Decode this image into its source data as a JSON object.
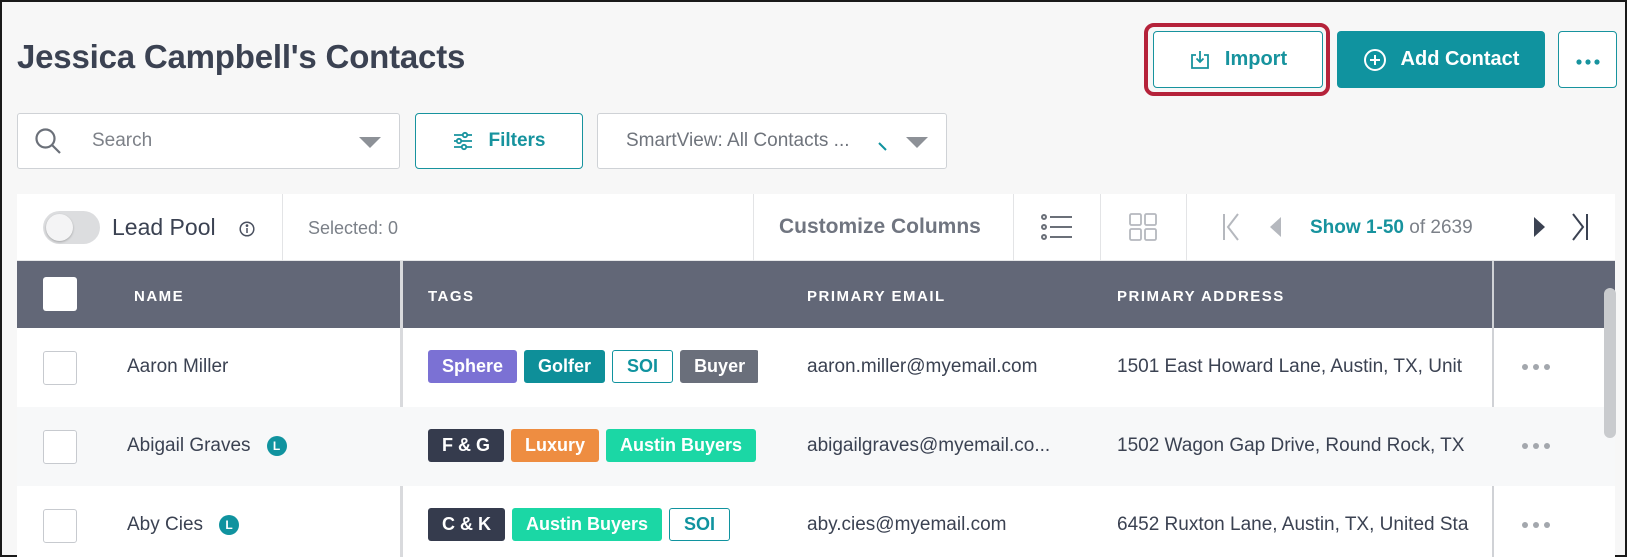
{
  "page": {
    "title": "Jessica Campbell's Contacts"
  },
  "header": {
    "import_label": "Import",
    "add_contact_label": "Add Contact",
    "more_icon": "ellipsis-icon"
  },
  "search": {
    "placeholder": "Search"
  },
  "filters": {
    "label": "Filters"
  },
  "smartview": {
    "label": "SmartView: All Contacts ..."
  },
  "toolbar": {
    "lead_pool_label": "Lead Pool",
    "selected_label": "Selected: 0",
    "customize_label": "Customize Columns",
    "pagination": {
      "range": "Show 1-50",
      "total": "of 2639"
    }
  },
  "table": {
    "columns": [
      "NAME",
      "TAGS",
      "PRIMARY EMAIL",
      "PRIMARY ADDRESS"
    ],
    "rows": [
      {
        "name": "Aaron Miller",
        "badge": "",
        "tags": [
          {
            "label": "Sphere",
            "style": "purple"
          },
          {
            "label": "Golfer",
            "style": "teal"
          },
          {
            "label": "SOI",
            "style": "outline"
          },
          {
            "label": "Buyer",
            "style": "gray"
          }
        ],
        "email": "aaron.miller@myemail.com",
        "address": "1501 East Howard Lane, Austin, TX, Unit"
      },
      {
        "name": "Abigail Graves",
        "badge": "L",
        "tags": [
          {
            "label": "F & G",
            "style": "dark"
          },
          {
            "label": "Luxury",
            "style": "orange"
          },
          {
            "label": "Austin Buyers",
            "style": "mint"
          }
        ],
        "email": "abigailgraves@myemail.co...",
        "address": "1502 Wagon Gap Drive, Round Rock, TX"
      },
      {
        "name": "Aby Cies",
        "badge": "L",
        "tags": [
          {
            "label": "C & K",
            "style": "dark"
          },
          {
            "label": "Austin Buyers",
            "style": "mint"
          },
          {
            "label": "SOI",
            "style": "outline"
          }
        ],
        "email": "aby.cies@myemail.com",
        "address": "6452 Ruxton Lane, Austin, TX, United Sta"
      }
    ]
  },
  "colors": {
    "accent": "#10939f",
    "highlight": "#b5223a",
    "header_bg": "#626777",
    "tag_purple": "#7b71d4",
    "tag_teal": "#0e8f99",
    "tag_gray": "#6a6f7b",
    "tag_dark": "#353b4d",
    "tag_orange": "#ee8d41",
    "tag_mint": "#1bd7a5"
  }
}
